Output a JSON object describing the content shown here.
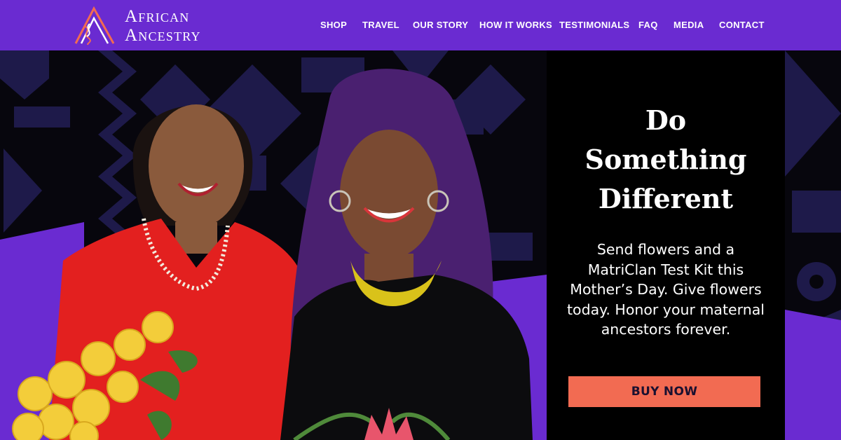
{
  "brand": {
    "name_line1": "African",
    "name_line2": "Ancestry",
    "accent": "#f26b52"
  },
  "nav": {
    "items": [
      {
        "label": "SHOP"
      },
      {
        "label": "TRAVEL"
      },
      {
        "label": "OUR STORY"
      },
      {
        "label": "HOW IT WORKS"
      },
      {
        "label": "TESTIMONIALS"
      },
      {
        "label": "FAQ"
      },
      {
        "label": "MEDIA"
      },
      {
        "label": "CONTACT"
      }
    ]
  },
  "hero": {
    "headline_line1": "Do",
    "headline_line2": "Something",
    "headline_line3": "Different",
    "body_line1": "Send flowers and a",
    "body_line2": "MatriClan Test Kit this",
    "body_line3": "Mother’s Day. Give flowers",
    "body_line4": "today. Honor your maternal",
    "body_line5": "ancestors forever.",
    "cta_label": "BUY NOW"
  },
  "colors": {
    "header_bg": "#6a2bd1",
    "pattern": "#1e1a4a",
    "hero_bg": "#07060d",
    "cta_bg": "#f26b52",
    "purple_shape": "#6a2bd1"
  }
}
